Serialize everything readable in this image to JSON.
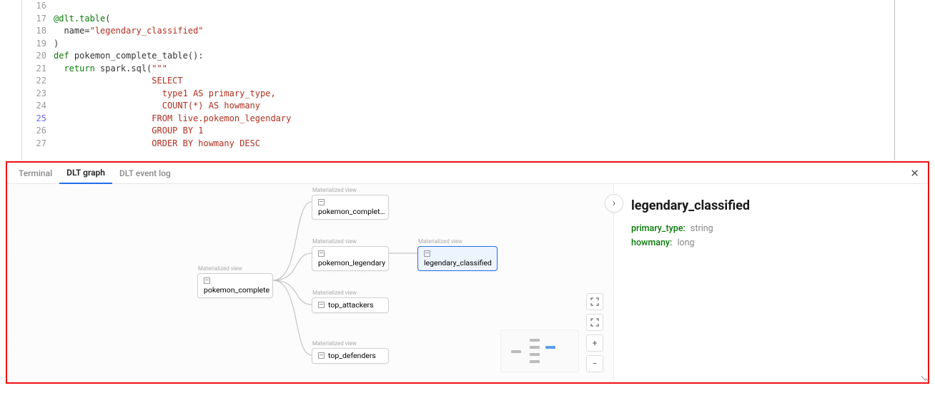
{
  "code": {
    "lines": [
      {
        "num": 16,
        "html": ""
      },
      {
        "num": 17,
        "html": "<span class='dec'>@dlt.table</span>("
      },
      {
        "num": 18,
        "html": "  name<span class='name'>=</span><span class='str'>\"legendary_classified\"</span>"
      },
      {
        "num": 19,
        "html": ")"
      },
      {
        "num": 20,
        "html": "<span class='kw'>def</span> <span class='func'>pokemon_complete_table</span>():"
      },
      {
        "num": 21,
        "html": "  <span class='kw'>return</span> spark.sql(<span class='str'>\"\"\"</span>"
      },
      {
        "num": 22,
        "html": "                   <span class='str'>SELECT</span>"
      },
      {
        "num": 23,
        "html": "                     <span class='str'>type1 AS primary_type,</span>"
      },
      {
        "num": 24,
        "html": "                     <span class='str'>COUNT(*) AS howmany</span>"
      },
      {
        "num": 25,
        "html": "                   <span class='str'>FROM live.pokemon_legendary</span>",
        "hl": true
      },
      {
        "num": 26,
        "html": "                   <span class='str'>GROUP BY 1</span>"
      },
      {
        "num": 27,
        "html": "                   <span class='str'>ORDER BY howmany DESC</span>"
      }
    ]
  },
  "tabs": {
    "terminal": "Terminal",
    "dlt_graph": "DLT graph",
    "dlt_event_log": "DLT event log"
  },
  "graph": {
    "mat_view_label": "Materialized view",
    "nodes": {
      "root": "pokemon_complete",
      "n1": "pokemon_complet…",
      "n2": "pokemon_legendary",
      "n3": "top_attackers",
      "n4": "top_defenders",
      "selected": "legendary_classified"
    }
  },
  "details": {
    "title": "legendary_classified",
    "schema": [
      {
        "name": "primary_type:",
        "type": "string"
      },
      {
        "name": "howmany:",
        "type": "long"
      }
    ]
  }
}
